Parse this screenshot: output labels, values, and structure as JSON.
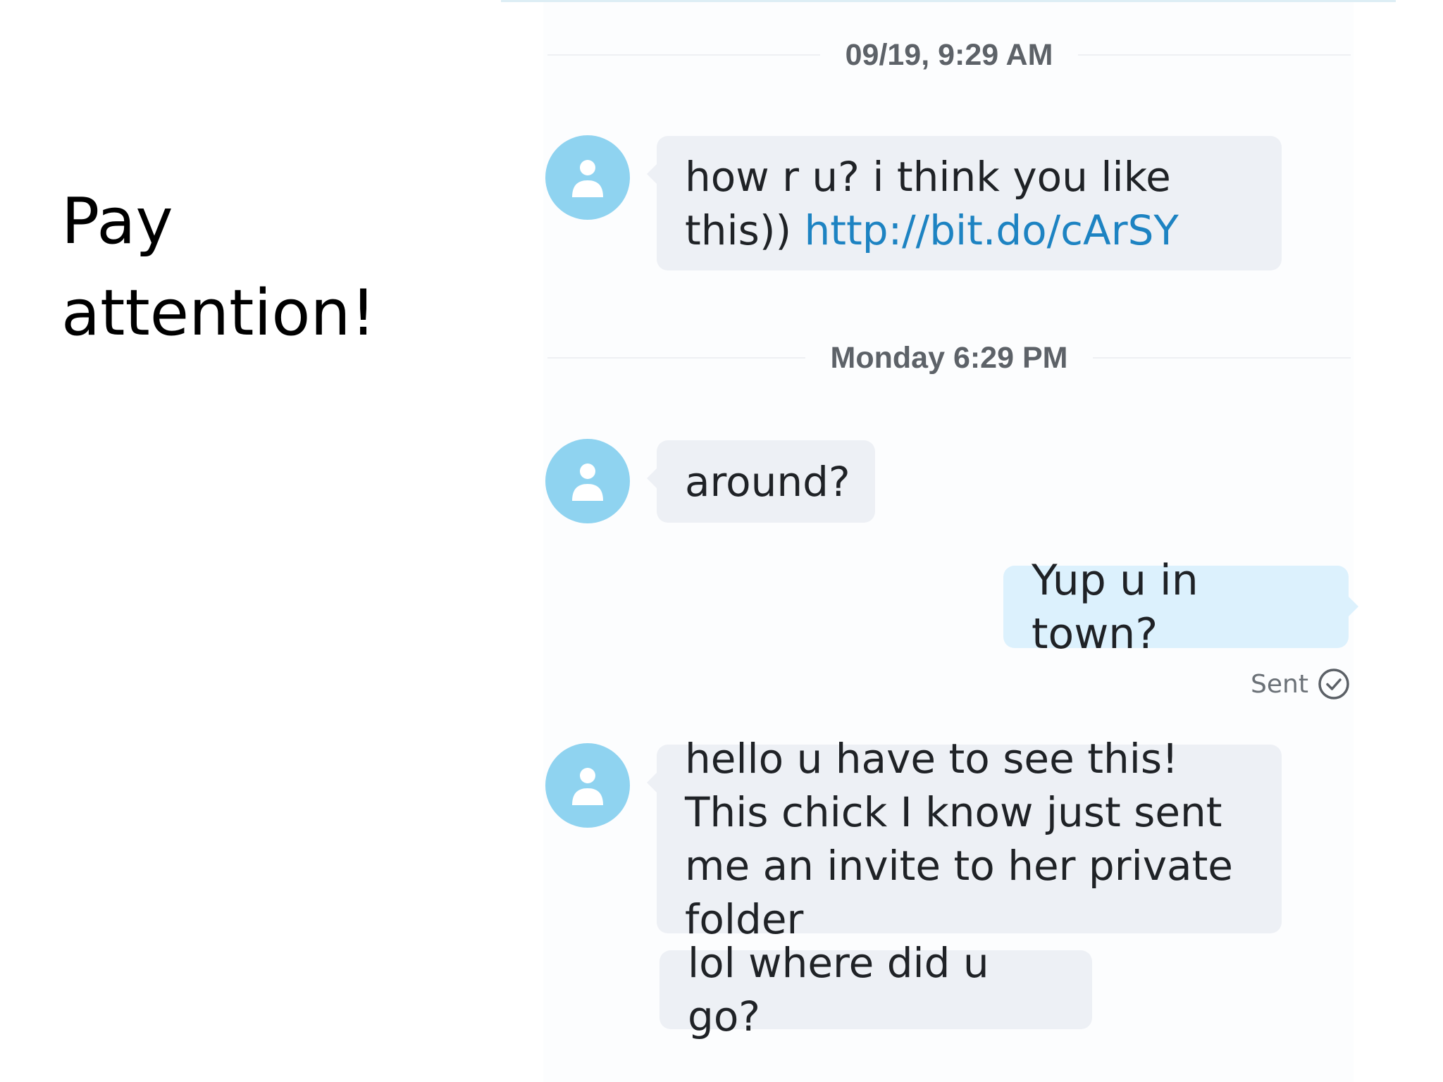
{
  "caption": {
    "line1": "Pay",
    "line2": "attention!"
  },
  "conversation": {
    "separators": [
      {
        "label": "09/19, 9:29 AM"
      },
      {
        "label": "Monday 6:29 PM"
      }
    ],
    "messages": [
      {
        "direction": "incoming",
        "avatar_icon": "user-avatar-icon",
        "text_before_link": "how r u? i think you like this))",
        "link_text": "http://bit.do/cArSY"
      },
      {
        "direction": "incoming",
        "avatar_icon": "user-avatar-icon",
        "text": "around?"
      },
      {
        "direction": "outgoing",
        "text": "Yup u in town?",
        "status": "Sent",
        "status_icon": "check-circle-icon"
      },
      {
        "direction": "incoming",
        "avatar_icon": "user-avatar-icon",
        "text": "hello u have to see this! This chick I know just sent me an invite to her private folder"
      },
      {
        "direction": "incoming",
        "text": "lol where did u go?"
      }
    ]
  },
  "colors": {
    "avatar": "#8fd3f0",
    "incoming_bubble": "#edf0f5",
    "outgoing_bubble": "#dcf1fd",
    "link": "#1d83c2",
    "timestamp": "#5d6268"
  }
}
